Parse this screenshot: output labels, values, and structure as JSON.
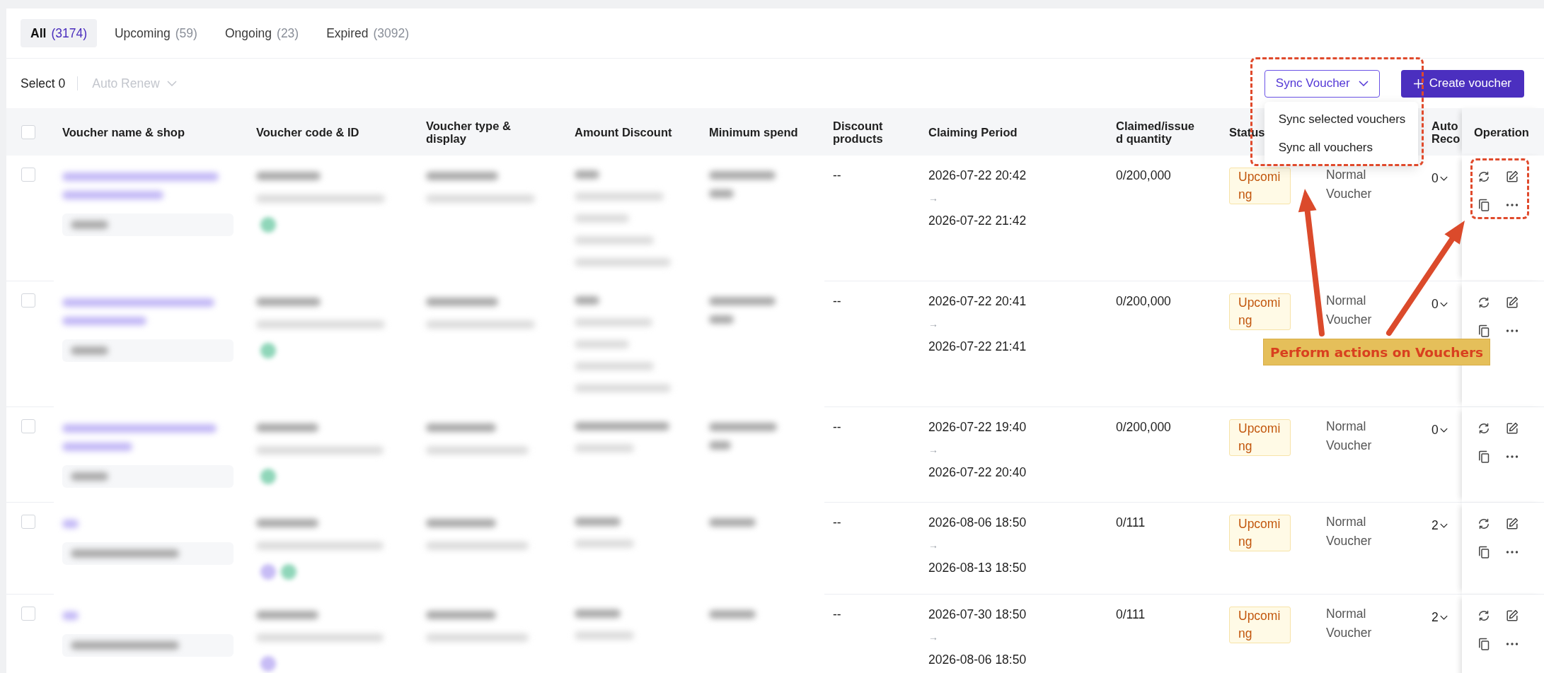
{
  "tabs": [
    {
      "label": "All",
      "count": "(3174)",
      "selected": true
    },
    {
      "label": "Upcoming",
      "count": "(59)",
      "selected": false
    },
    {
      "label": "Ongoing",
      "count": "(23)",
      "selected": false
    },
    {
      "label": "Expired",
      "count": "(3092)",
      "selected": false
    }
  ],
  "toolbar": {
    "selection": "Select 0",
    "auto_renew": {
      "label": "Auto Renew",
      "disabled": true
    },
    "sync_voucher": {
      "label": "Sync Voucher",
      "expanded": true,
      "menu": [
        "Sync selected vouchers",
        "Sync all vouchers"
      ]
    },
    "create_voucher": {
      "label": "Create voucher"
    }
  },
  "table": {
    "select_all": {
      "checked": false
    },
    "columns": [
      "Voucher name & shop",
      "Voucher code & ID",
      "Voucher type & display",
      "Amount Discount",
      "Minimum spend",
      "Discount products",
      "Claiming Period",
      "Claimed/issued quantity",
      "Status",
      "Auto Reco",
      "Operation"
    ],
    "rows": [
      {
        "checked": false,
        "discount_products": "--",
        "claim_start": "2026-07-22 20:42",
        "claim_arrow": "→",
        "claim_end": "2026-07-22 21:42",
        "claimed_quantity": "0/200,000",
        "status": "Upcoming",
        "voucher_type": "Normal Voucher",
        "auto_renew": "0"
      },
      {
        "checked": false,
        "discount_products": "--",
        "claim_start": "2026-07-22 20:41",
        "claim_arrow": "→",
        "claim_end": "2026-07-22 21:41",
        "claimed_quantity": "0/200,000",
        "status": "Upcoming",
        "voucher_type": "Normal Voucher",
        "auto_renew": "0"
      },
      {
        "checked": false,
        "discount_products": "--",
        "claim_start": "2026-07-22 19:40",
        "claim_arrow": "→",
        "claim_end": "2026-07-22 20:40",
        "claimed_quantity": "0/200,000",
        "status": "Upcoming",
        "voucher_type": "Normal Voucher",
        "auto_renew": "0"
      },
      {
        "checked": false,
        "discount_products": "--",
        "claim_start": "2026-08-06 18:50",
        "claim_arrow": "→",
        "claim_end": "2026-08-13 18:50",
        "claimed_quantity": "0/111",
        "status": "Upcoming",
        "voucher_type": "Normal Voucher",
        "auto_renew": "2"
      },
      {
        "checked": false,
        "discount_products": "--",
        "claim_start": "2026-07-30 18:50",
        "claim_arrow": "→",
        "claim_end": "2026-08-06 18:50",
        "claimed_quantity": "0/111",
        "status": "Upcoming",
        "voucher_type": "Normal Voucher",
        "auto_renew": "2"
      }
    ]
  },
  "annotation": {
    "label": "Perform actions on Vouchers"
  }
}
